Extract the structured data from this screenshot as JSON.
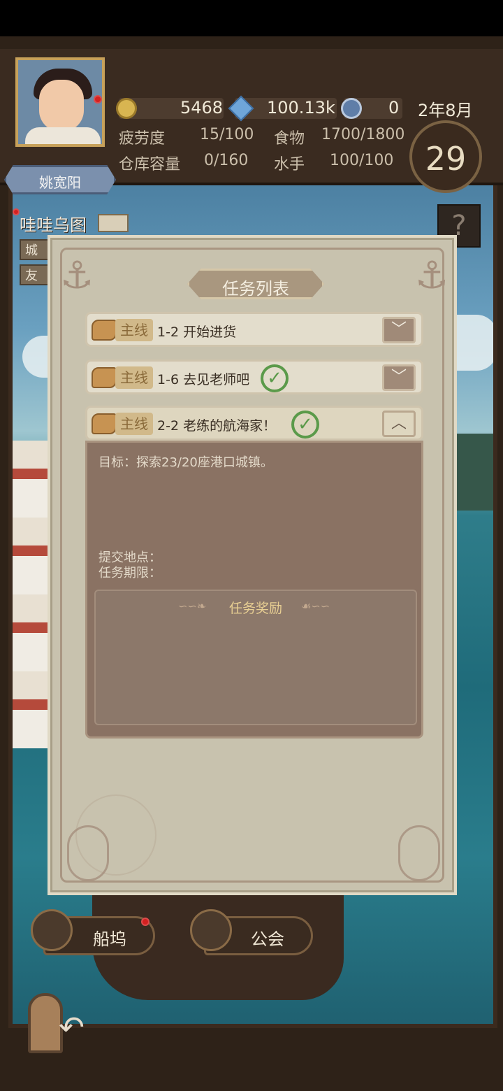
{
  "player": {
    "name": "姚宽阳",
    "gold": "5468",
    "gems": "100.13k",
    "badges": "0",
    "date": "2年8月",
    "day": "29"
  },
  "stats": {
    "fatigue_label": "疲劳度",
    "fatigue_value": "15/100",
    "food_label": "食物",
    "food_value": "1700/1800",
    "storage_label": "仓库容量",
    "storage_value": "0/160",
    "sailors_label": "水手",
    "sailors_value": "100/100"
  },
  "port": {
    "name": "哇哇乌图",
    "tag1": "城",
    "tag2": "友"
  },
  "help_label": "?",
  "dock": {
    "shipyard_label": "船坞",
    "guild_label": "公会"
  },
  "dialog": {
    "title": "任务列表",
    "quests": [
      {
        "tag": "主线",
        "title": "1-2 开始进货",
        "completed": false,
        "expanded": false
      },
      {
        "tag": "主线",
        "title": "1-6 去见老师吧",
        "completed": true,
        "expanded": false
      },
      {
        "tag": "主线",
        "title": "2-2 老练的航海家！",
        "completed": true,
        "expanded": true
      }
    ],
    "detail": {
      "goal": "目标：探索23/20座港口城镇。",
      "submit_location": "提交地点：",
      "deadline": "任务期限：",
      "reward_title": "任务奖励"
    }
  },
  "colors": {
    "hud_bg": "#3a2b20",
    "dialog_bg": "#c8c2ae",
    "detail_bg": "#8a7263",
    "check_green": "#5b9a4a",
    "notify_red": "#d42020"
  }
}
